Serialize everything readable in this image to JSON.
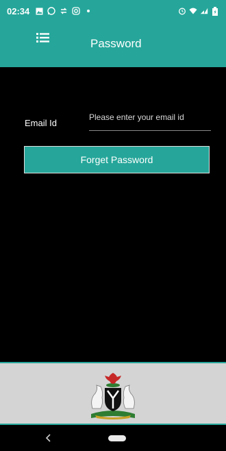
{
  "status_bar": {
    "time": "02:34",
    "left_icons": [
      "gallery-icon",
      "whatsapp-icon",
      "transfer-icon",
      "instagram-icon",
      "dot-icon"
    ],
    "right_icons": [
      "alarm-icon",
      "wifi-icon",
      "signal-icon",
      "battery-icon"
    ]
  },
  "app_bar": {
    "title": "Password",
    "menu_icon": "list-icon",
    "color": "#26a69a"
  },
  "form": {
    "email_label": "Email Id",
    "email_value": "",
    "email_placeholder": "Please enter your email id",
    "button_label": "Forget Password"
  },
  "footer": {
    "image": "coat-of-arms-icon"
  },
  "nav_bar": {
    "back_icon": "back-chevron-icon",
    "home_icon": "home-pill-icon"
  }
}
